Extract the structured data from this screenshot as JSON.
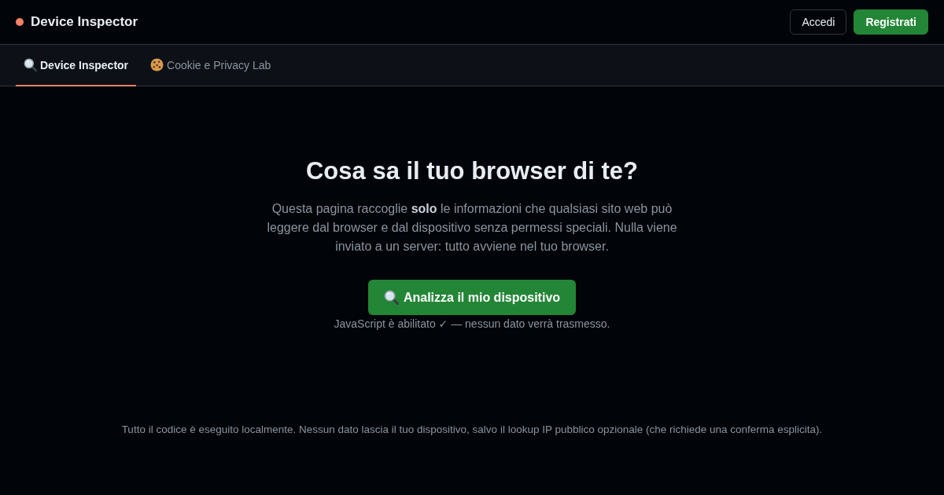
{
  "header": {
    "title": "Device Inspector",
    "buttons": [
      {
        "label": "Accedi",
        "kind": "outline"
      },
      {
        "label": "Registrati",
        "kind": "primary"
      }
    ]
  },
  "tabs": [
    {
      "label": "Device Inspector",
      "selected": true
    },
    {
      "label": "Cookie e Privacy Lab",
      "selected": false
    }
  ],
  "hero": {
    "title": "Cosa sa il tuo browser di te?",
    "description": "Questa pagina raccoglie **solo** le informazioni che qualsiasi sito web può leggere dal browser e dal dispositivo senza permessi speciali. Nulla viene inviato a un server: tutto avviene nel tuo browser.",
    "button": "Analizza il mio dispositivo",
    "note": "JavaScript è abilitato ✓ — nessun dato verrà trasmesso."
  },
  "footer": "Tutto il codice è eseguito localmente. Nessun dato lascia il tuo dispositivo, salvo il lookup IP pubblico opzionale (che richiede una conferma esplicita)."
}
